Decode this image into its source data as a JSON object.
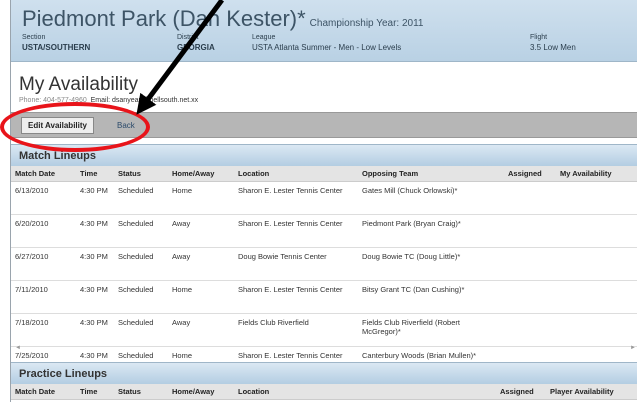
{
  "header": {
    "team": "Piedmont Park (Dan Kester)*",
    "championship": "Championship Year: 2011",
    "section_label": "Section",
    "section_value": "USTA/SOUTHERN",
    "district_label": "District",
    "district_value": "GEORGIA",
    "league_label": "League",
    "league_value": "USTA Atlanta Summer - Men - Low Levels",
    "flight_label": "Flight",
    "flight_value": "3.5 Low Men"
  },
  "page": {
    "title": "My Availability",
    "phone": "Phone: 404-577-4960",
    "email": "Email: dsanyeau@bellsouth.net.xx"
  },
  "toolbar": {
    "edit_label": "Edit Availability",
    "back_label": "Back"
  },
  "match_lineups": {
    "title": "Match Lineups",
    "columns": [
      "Match Date",
      "Time",
      "Status",
      "Home/Away",
      "Location",
      "Opposing Team",
      "Assigned",
      "My Availability"
    ],
    "rows": [
      [
        "6/13/2010",
        "4:30 PM",
        "Scheduled",
        "Home",
        "Sharon E. Lester Tennis Center",
        "Gates Mill (Chuck Orlowski)*",
        "",
        ""
      ],
      [
        "6/20/2010",
        "4:30 PM",
        "Scheduled",
        "Away",
        "Sharon E. Lester Tennis Center",
        "Piedmont Park (Bryan Craig)*",
        "",
        ""
      ],
      [
        "6/27/2010",
        "4:30 PM",
        "Scheduled",
        "Away",
        "Doug Bowie Tennis Center",
        "Doug Bowie TC (Doug Little)*",
        "",
        ""
      ],
      [
        "7/11/2010",
        "4:30 PM",
        "Scheduled",
        "Home",
        "Sharon E. Lester Tennis Center",
        "Bitsy Grant TC (Dan Cushing)*",
        "",
        ""
      ],
      [
        "7/18/2010",
        "4:30 PM",
        "Scheduled",
        "Away",
        "Fields Club Riverfield",
        "Fields Club Riverfield (Robert McGregor)*",
        "",
        ""
      ],
      [
        "7/25/2010",
        "4:30 PM",
        "Scheduled",
        "Home",
        "Sharon E. Lester Tennis Center",
        "Canterbury Woods (Brian Mullen)*",
        "",
        ""
      ]
    ]
  },
  "practice_lineups": {
    "title": "Practice Lineups",
    "columns": [
      "Match Date",
      "Time",
      "Status",
      "Home/Away",
      "Location",
      "Assigned",
      "Player Availability"
    ]
  },
  "annotation": {
    "circle_color": "#e8141a",
    "arrow_color": "#000000"
  }
}
